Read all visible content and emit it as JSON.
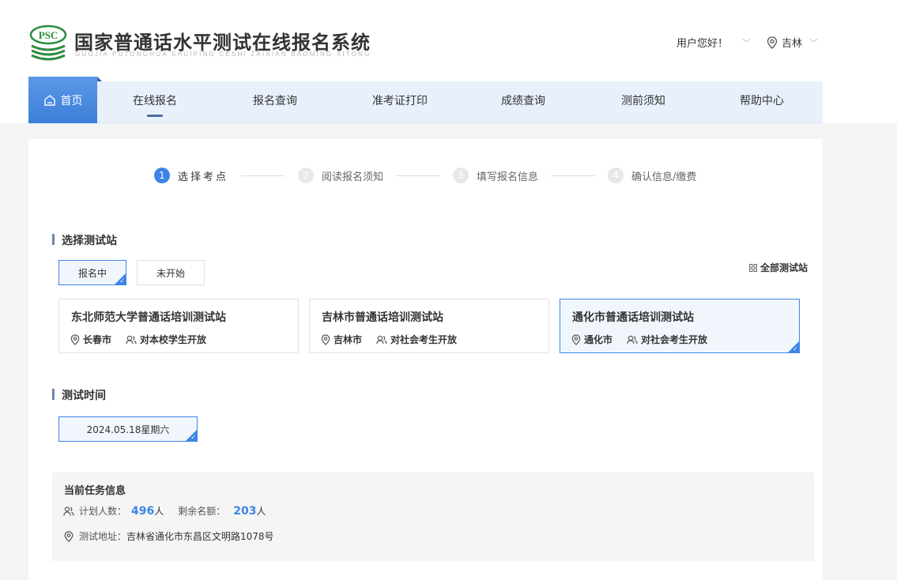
{
  "header": {
    "logo_text": "PSC",
    "title": "国家普通话水平测试在线报名系统",
    "subtitle": "GUOJIA PUTONGHUA SHUIPING CESHI ZAIXIAN BAOMING XITONG",
    "greeting": "用户您好！",
    "city": "吉林"
  },
  "nav": {
    "home": "首页",
    "items": [
      "在线报名",
      "报名查询",
      "准考证打印",
      "成绩查询",
      "测前须知",
      "帮助中心"
    ]
  },
  "steps": [
    {
      "num": "1",
      "label": "选择考点"
    },
    {
      "num": "2",
      "label": "阅读报名须知"
    },
    {
      "num": "3",
      "label": "填写报名信息"
    },
    {
      "num": "4",
      "label": "确认信息/缴费"
    }
  ],
  "station_section": {
    "title": "选择测试站",
    "filters": [
      "报名中",
      "未开始"
    ],
    "all_link": "全部测试站"
  },
  "stations": [
    {
      "name": "东北师范大学普通话培训测试站",
      "city": "长春市",
      "audience": "对本校学生开放"
    },
    {
      "name": "吉林市普通话培训测试站",
      "city": "吉林市",
      "audience": "对社会考生开放"
    },
    {
      "name": "通化市普通话培训测试站",
      "city": "通化市",
      "audience": "对社会考生开放"
    }
  ],
  "time_section": {
    "title": "测试时间",
    "date": "2024.05.18星期六"
  },
  "task": {
    "title": "当前任务信息",
    "planned_label": "计划人数：",
    "planned": "496",
    "remaining_label": "剩余名额：",
    "remaining": "203",
    "unit": "人",
    "address_label": "测试地址：",
    "address": "吉林省通化市东昌区文明路1078号"
  },
  "colors": {
    "accent": "#3d84e8",
    "nav_bg": "#e8f1fb",
    "logo_green": "#2e8b3e"
  }
}
